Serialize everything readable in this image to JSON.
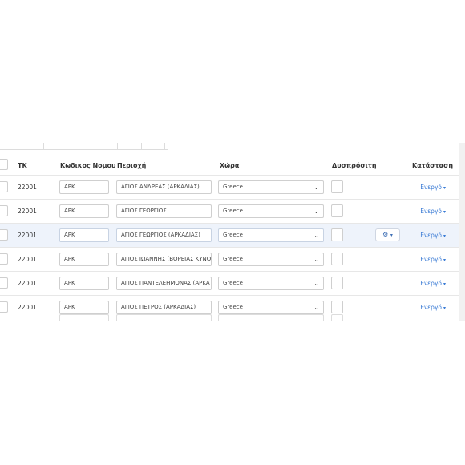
{
  "table": {
    "columns": {
      "tk": "ΤΚ",
      "code": "Κωδικος Νομου",
      "area": "Περιοχή",
      "country": "Χώρα",
      "available": "Δυσπρόσιτη",
      "status": "Κατάσταση"
    },
    "rows": [
      {
        "tk": "22001",
        "code": "ΑΡΚ",
        "area": "ΑΓΙΟΣ ΑΝΔΡΕΑΣ (ΑΡΚΑΔΙΑΣ)",
        "country": "Greece",
        "status": "Ενεργό"
      },
      {
        "tk": "22001",
        "code": "ΑΡΚ",
        "area": "ΑΓΙΟΣ ΓΕΩΡΓΙΟΣ",
        "country": "Greece",
        "status": "Ενεργό"
      },
      {
        "tk": "22001",
        "code": "ΑΡΚ",
        "area": "ΑΓΙΟΣ ΓΕΩΡΓΙΟΣ (ΑΡΚΑΔΙΑΣ)",
        "country": "Greece",
        "status": "Ενεργό"
      },
      {
        "tk": "22001",
        "code": "ΑΡΚ",
        "area": "ΑΓΙΟΣ ΙΩΑΝΝΗΣ (ΒΟΡΕΙΑΣ ΚΥΝΟ",
        "country": "Greece",
        "status": "Ενεργό"
      },
      {
        "tk": "22001",
        "code": "ΑΡΚ",
        "area": "ΑΓΙΟΣ ΠΑΝΤΕΛΕΗΜΟΝΑΣ (ΑΡΚΑ",
        "country": "Greece",
        "status": "Ενεργό"
      },
      {
        "tk": "22001",
        "code": "ΑΡΚ",
        "area": "ΑΓΙΟΣ ΠΕΤΡΟΣ (ΑΡΚΑΔΙΑΣ)",
        "country": "Greece",
        "status": "Ενεργό"
      }
    ],
    "selected_row_index": 2,
    "icons": {
      "row_action": "gear-icon",
      "dropdown": "chevron-down-icon",
      "status_dropdown": "caret-down-icon"
    },
    "colors": {
      "status_link": "#3a7bd5",
      "selected_row": "#eef3fb"
    }
  }
}
